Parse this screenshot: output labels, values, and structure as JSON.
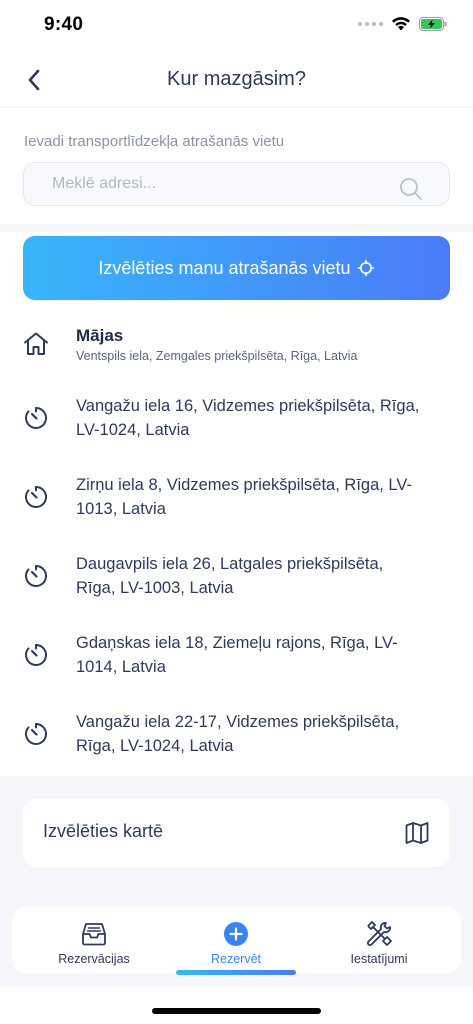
{
  "status_bar": {
    "time": "9:40"
  },
  "header": {
    "title": "Kur mazgāsim?"
  },
  "search": {
    "label": "Ievadi transportlīdzekļa atrašanās vietu",
    "placeholder": "Meklē adresi..."
  },
  "location_button": {
    "label": "Izvēlēties manu atrašanās vietu"
  },
  "home": {
    "title": "Mājas",
    "address": "Ventspils iela, Zemgales priekšpilsēta, Rīga, Latvia"
  },
  "recent": [
    {
      "address": "Vangažu iela 16, Vidzemes priekšpilsēta, Rīga, LV-1024, Latvia"
    },
    {
      "address": "Zirņu iela 8, Vidzemes priekšpilsēta, Rīga, LV-1013, Latvia"
    },
    {
      "address": "Daugavpils iela 26, Latgales priekšpilsēta, Rīga, LV-1003, Latvia"
    },
    {
      "address": "Gdaņskas iela 18, Ziemeļu rajons, Rīga, LV-1014, Latvia"
    },
    {
      "address": "Vangažu iela 22-17, Vidzemes priekšpilsēta, Rīga, LV-1024, Latvia"
    }
  ],
  "map_option": {
    "label": "Izvēlēties kartē"
  },
  "tabs": [
    {
      "label": "Rezervācijas",
      "icon": "inbox-icon"
    },
    {
      "label": "Rezervēt",
      "icon": "plus-circle-icon"
    },
    {
      "label": "Iestatījumi",
      "icon": "tools-icon"
    }
  ],
  "colors": {
    "primary_text": "#2e3a59",
    "accent_start": "#38b6fb",
    "accent_end": "#4a7cf7",
    "active_tab": "#3b82f6"
  }
}
